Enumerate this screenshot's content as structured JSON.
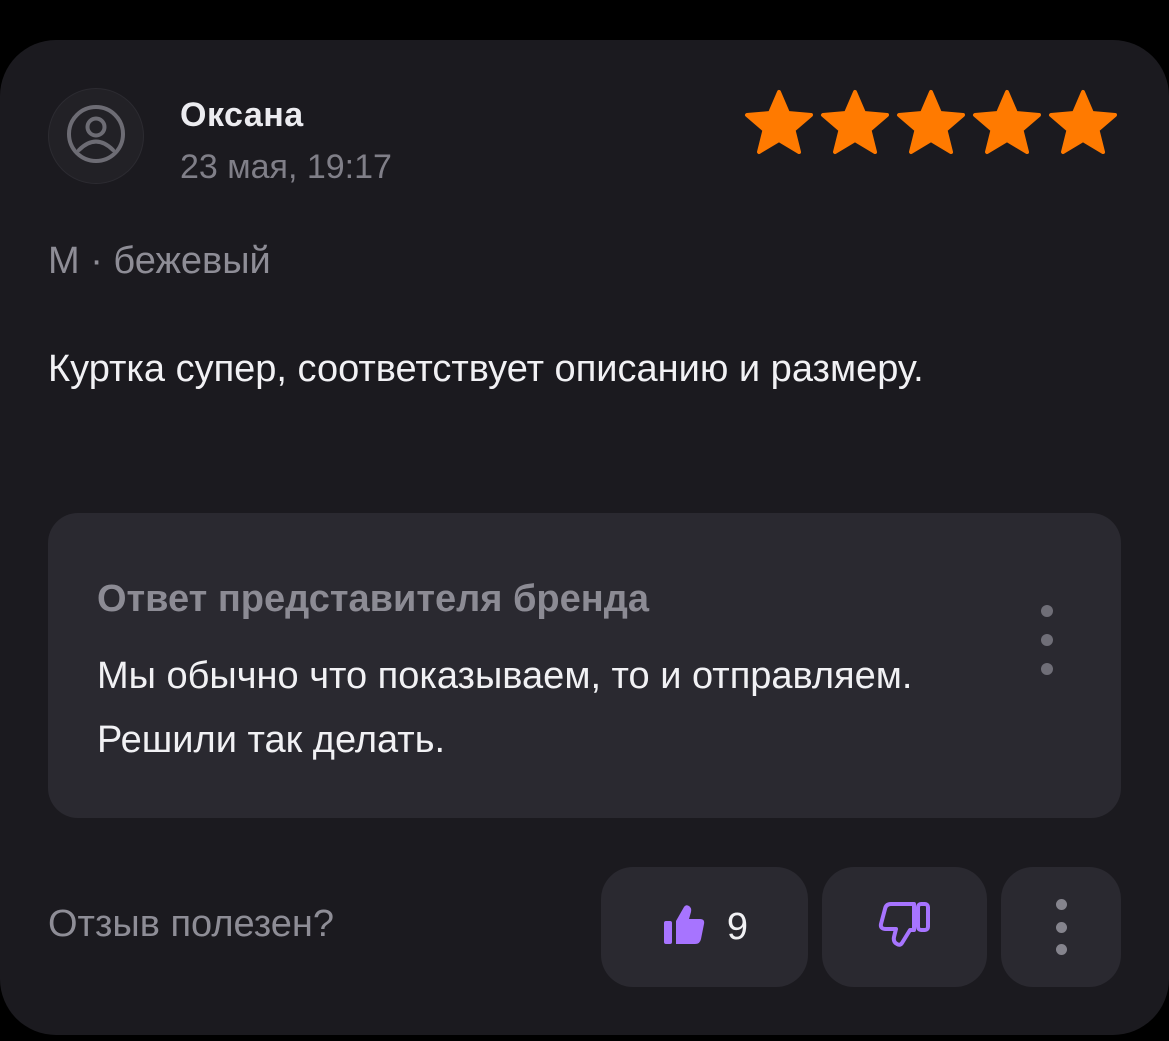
{
  "review": {
    "author": "Оксана",
    "date": "23 мая, 19:17",
    "rating": 5,
    "rating_max": 5,
    "variant": "М · бежевый",
    "text": "Куртка супер, соответствует описанию и размеру."
  },
  "brand_answer": {
    "title": "Ответ представителя бренда",
    "text": "Мы обычно что показываем, то и отправляем. Решили так делать."
  },
  "footer": {
    "question": "Отзыв полезен?",
    "likes": "9"
  },
  "icons": {
    "avatar": "user-circle-icon",
    "star": "star-icon",
    "like": "thumbs-up-icon",
    "dislike": "thumbs-down-icon",
    "more": "more-vertical-icon"
  },
  "colors": {
    "background": "#1b1a1f",
    "panel": "#2a2930",
    "star": "#ff7a00",
    "accent": "#a774ff"
  }
}
